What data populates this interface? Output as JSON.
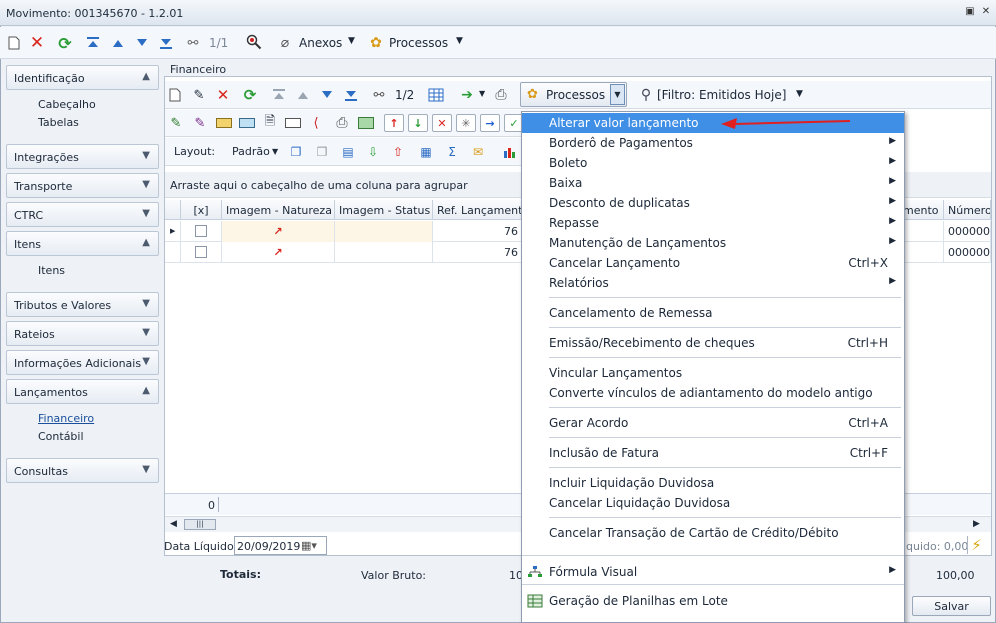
{
  "window": {
    "title": "Movimento: 001345670 - 1.2.01"
  },
  "toolbar": {
    "page": "1/1",
    "anexos": "Anexos",
    "processos": "Processos"
  },
  "sidebar": {
    "groups": [
      {
        "label": "Identificação",
        "sub": [
          "Cabeçalho",
          "Tabelas"
        ]
      },
      {
        "label": "Integrações"
      },
      {
        "label": "Transporte"
      },
      {
        "label": "CTRC"
      },
      {
        "label": "Itens",
        "sub": [
          "Itens"
        ]
      },
      {
        "label": "Tributos e Valores"
      },
      {
        "label": "Rateios"
      },
      {
        "label": "Informações Adicionais"
      },
      {
        "label": "Lançamentos",
        "sub": [
          "Financeiro",
          "Contábil"
        ]
      },
      {
        "label": "Consultas"
      }
    ]
  },
  "panel": {
    "title": "Financeiro",
    "page": "1/2",
    "processos": "Processos",
    "filter": "[Filtro: Emitidos Hoje]",
    "layout_label": "Layout:",
    "layout_value": "Padrão",
    "group_hint": "Arraste aqui o cabeçalho de uma coluna para agrupar",
    "columns": {
      "sel": "[x]",
      "natureza": "Imagem - Natureza",
      "status": "Imagem - Status",
      "ref": "Ref. Lançamento",
      "mento": "mento",
      "numero": "Número"
    },
    "rows": [
      {
        "ref": "76",
        "numero": "000000"
      },
      {
        "ref": "76",
        "numero": "000000"
      }
    ],
    "footer_count": "0",
    "data_liquido_label": "Data Líquido:",
    "data_liquido": "20/09/2019",
    "liquido_label": "quido: 0,00"
  },
  "totals": {
    "label": "Totais:",
    "valor_bruto_label": "Valor Bruto:",
    "valor_bruto": "10",
    "total": "100,00",
    "save": "Salvar"
  },
  "menu": {
    "items": [
      {
        "label": "Alterar valor lançamento",
        "shortcut": "",
        "arrow": false
      },
      {
        "label": "Borderô de Pagamentos",
        "shortcut": "",
        "arrow": true
      },
      {
        "label": "Boleto",
        "shortcut": "",
        "arrow": true
      },
      {
        "label": "Baixa",
        "shortcut": "",
        "arrow": true
      },
      {
        "label": "Desconto de duplicatas",
        "shortcut": "",
        "arrow": true
      },
      {
        "label": "Repasse",
        "shortcut": "",
        "arrow": true
      },
      {
        "label": "Manutenção de Lançamentos",
        "shortcut": "",
        "arrow": true
      },
      {
        "label": "Cancelar Lançamento",
        "shortcut": "Ctrl+X",
        "arrow": false
      },
      {
        "label": "Relatórios",
        "shortcut": "",
        "arrow": true
      },
      {
        "label": "Cancelamento de Remessa",
        "shortcut": "",
        "arrow": false
      },
      {
        "label": "Emissão/Recebimento de cheques",
        "shortcut": "Ctrl+H",
        "arrow": false
      },
      {
        "label": "Vincular Lançamentos",
        "shortcut": "",
        "arrow": false
      },
      {
        "label": "Converte vínculos de adiantamento do modelo antigo",
        "shortcut": "",
        "arrow": false
      },
      {
        "label": "Gerar Acordo",
        "shortcut": "Ctrl+A",
        "arrow": false
      },
      {
        "label": "Inclusão de Fatura",
        "shortcut": "Ctrl+F",
        "arrow": false
      },
      {
        "label": "Incluir Liquidação Duvidosa",
        "shortcut": "",
        "arrow": false
      },
      {
        "label": "Cancelar Liquidação Duvidosa",
        "shortcut": "",
        "arrow": false
      },
      {
        "label": "Cancelar Transação de Cartão de Crédito/Débito",
        "shortcut": "",
        "arrow": false
      },
      {
        "label": "Fórmula Visual",
        "shortcut": "",
        "arrow": true
      },
      {
        "label": "Geração de Planilhas em Lote",
        "shortcut": "",
        "arrow": false
      }
    ]
  },
  "colors": {
    "highlight": "#3f8fe6",
    "annotation_arrow": "#e02020"
  }
}
